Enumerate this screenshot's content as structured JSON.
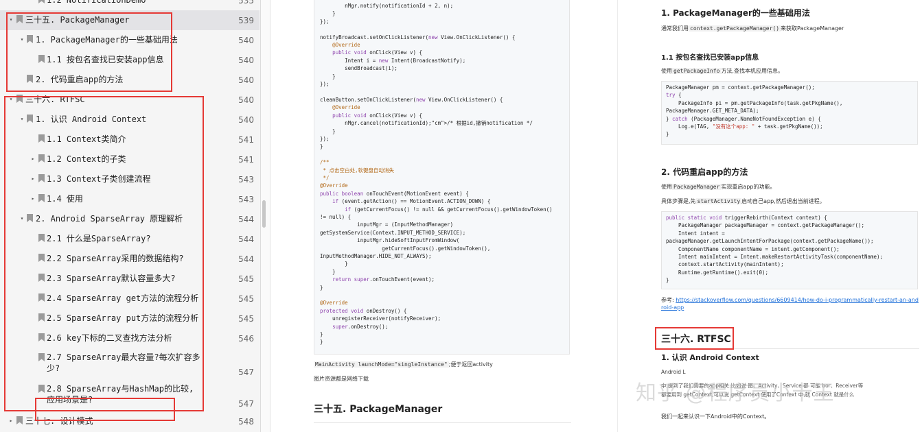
{
  "outline": {
    "items": [
      {
        "level": 2,
        "chevron": "",
        "label": "1.2 NotificationDemo",
        "page": "535"
      },
      {
        "level": 0,
        "chevron": "▾",
        "label": "三十五. PackageManager",
        "page": "539",
        "selected": true
      },
      {
        "level": 1,
        "chevron": "▾",
        "label": "1. PackageManager的一些基础用法",
        "page": "540"
      },
      {
        "level": 2,
        "chevron": "",
        "label": "1.1 按包名查找已安装app信息",
        "page": "540"
      },
      {
        "level": 1,
        "chevron": "",
        "label": "2. 代码重启app的方法",
        "page": "540"
      },
      {
        "level": 0,
        "chevron": "▾",
        "label": "三十六. RTFSC",
        "page": "540"
      },
      {
        "level": 1,
        "chevron": "▾",
        "label": "1. 认识 Android Context",
        "page": "540"
      },
      {
        "level": 2,
        "chevron": "",
        "label": "1.1 Context类简介",
        "page": "541"
      },
      {
        "level": 2,
        "chevron": "▸",
        "label": "1.2 Context的子类",
        "page": "541"
      },
      {
        "level": 2,
        "chevron": "▸",
        "label": "1.3 Context子类创建流程",
        "page": "543"
      },
      {
        "level": 2,
        "chevron": "▸",
        "label": "1.4 使用",
        "page": "543"
      },
      {
        "level": 1,
        "chevron": "▾",
        "label": "2. Android SparseArray 原理解析",
        "page": "544"
      },
      {
        "level": 2,
        "chevron": "",
        "label": "2.1 什么是SparseArray?",
        "page": "544"
      },
      {
        "level": 2,
        "chevron": "",
        "label": "2.2 SparseArray采用的数据结构?",
        "page": "544"
      },
      {
        "level": 2,
        "chevron": "",
        "label": "2.3 SparseArray默认容量多大?",
        "page": "545"
      },
      {
        "level": 2,
        "chevron": "",
        "label": "2.4 SparseArray get方法的流程分析",
        "page": "545"
      },
      {
        "level": 2,
        "chevron": "",
        "label": "2.5 SparseArray put方法的流程分析",
        "page": "545"
      },
      {
        "level": 2,
        "chevron": "",
        "label": "2.6 key下标的二叉查找方法分析",
        "page": "546"
      },
      {
        "level": 2,
        "chevron": "",
        "label": "2.7 SparseArray最大容量?每次扩容多少?",
        "page": "547",
        "tall": true
      },
      {
        "level": 2,
        "chevron": "",
        "label": "2.8 SparseArray与HashMap的比较,应用场景是?",
        "page": "547",
        "tall": true
      },
      {
        "level": 0,
        "chevron": "▸",
        "label": "三十七. 设计模式",
        "page": "548"
      }
    ]
  },
  "page_left": {
    "code_lines": [
      "        nMgr.notify(notificationId + 2, n);",
      "    }",
      "});",
      "",
      "notifyBroadcast.setOnClickListener(new View.OnClickListener() {",
      "    @Override",
      "    public void onClick(View v) {",
      "        Intent i = new Intent(BroadcastNotify);",
      "        sendBroadcast(i);",
      "    }",
      "});",
      "",
      "cleanButton.setOnClickListener(new View.OnClickListener() {",
      "    @Override",
      "    public void onClick(View v) {",
      "        nMgr.cancel(notificationId);/* 根据id,撤销notification */",
      "    }",
      "});",
      "}",
      "",
      "/**",
      " * 点击空白处,软键盘自动消失",
      " */",
      "@Override",
      "public boolean onTouchEvent(MotionEvent event) {",
      "    if (event.getAction() == MotionEvent.ACTION_DOWN) {",
      "        if (getCurrentFocus() != null && getCurrentFocus().getWindowToken()",
      "!= null) {",
      "            inputMgr = (InputMethodManager)",
      "getSystemService(Context.INPUT_METHOD_SERVICE);",
      "            inputMgr.hideSoftInputFromWindow(",
      "                    getCurrentFocus().getWindowToken(),",
      "InputMethodManager.HIDE_NOT_ALWAYS);",
      "        }",
      "    }",
      "    return super.onTouchEvent(event);",
      "}",
      "",
      "@Override",
      "protected void onDestroy() {",
      "    unregisterReceiver(notifyReceiver);",
      "    super.onDestroy();",
      "}",
      "}"
    ],
    "note_code": "MainActivity launchMode=\"singleInstance\"",
    "note_text": ";便于返回activity",
    "note2": "图片资源都是网络下载",
    "heading": "三十五. PackageManager"
  },
  "page_right": {
    "h_basic": "1. PackageManager的一些基础用法",
    "intro_pre": "通常我们用",
    "intro_code": "context.getPackageManager()",
    "intro_post": "来获取PackageManager",
    "h_find": "1.1 按包名查找已安装app信息",
    "find_pre": "使用",
    "find_code": "getPackageInfo",
    "find_post": "方法,查找本机应用信息。",
    "code1": [
      "PackageManager pm = context.getPackageManager();",
      "try {",
      "    PackageInfo pi = pm.getPackageInfo(task.getPkgName(),",
      "PackageManager.GET_META_DATA);",
      "} catch (PackageManager.NameNotFoundException e) {",
      "    Log.e(TAG, \"没有这个app: \" + task.getPkgName());",
      "}"
    ],
    "h_restart": "2. 代码重启app的方法",
    "restart_pre": "使用",
    "restart_code": "PackageManager",
    "restart_post": "实现重启app的功能。",
    "steps_pre": "具体步骤是,先",
    "steps_code": "startActivity",
    "steps_post": "启动自己app,然后退出当前进程。",
    "code2": [
      "public static void triggerRebirth(Context context) {",
      "    PackageManager packageManager = context.getPackageManager();",
      "    Intent intent =",
      "packageManager.getLaunchIntentForPackage(context.getPackageName());",
      "    ComponentName componentName = intent.getComponent();",
      "    Intent mainIntent = Intent.makeRestartActivityTask(componentName);",
      "    context.startActivity(mainIntent);",
      "    Runtime.getRuntime().exit(0);",
      "}"
    ],
    "ref_label": "参考:",
    "ref_url": "https://stackoverflow.com/questions/6609414/how-do-i-programmatically-restart-an-android-app",
    "h_rtfsc": "三十六. RTFSC",
    "h_context": "1. 认识 Android Context",
    "android_l": "Android L",
    "ghost1": "中,提到了我们需要的app相关:比如说 图、Activity、Service 都 可能 bor、Receiver等",
    "ghost2": "都要用到 getContext,可以说 getContext 使用了Context 中,就 Context 就是什么",
    "last_line": "我们一起来认识一下Android中的Context。",
    "watermark": "知乎 @程序员小卡王"
  }
}
